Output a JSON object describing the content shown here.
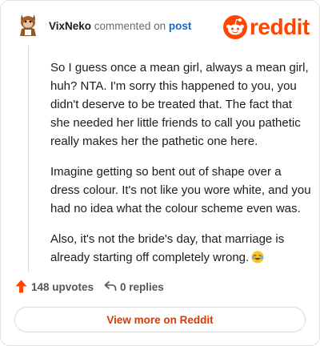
{
  "header": {
    "username": "VixNeko",
    "action_text": "commented on",
    "post_link_label": "post"
  },
  "brand": {
    "wordmark": "reddit",
    "color": "#ff4500"
  },
  "comment": {
    "paragraphs": [
      "So I guess once a mean girl, always a mean girl, huh? NTA. I'm sorry this happened to you, you didn't deserve to be treated that. The fact that she needed her little friends to call you pathetic really makes her the pathetic one here.",
      "Imagine getting so bent out of shape over a dress colour. It's not like you wore white, and you had no idea what the colour scheme even was.",
      "Also, it's not the bride's day, that marriage is already starting off completely wrong."
    ],
    "trailing_emoji": "laughing-tears-emoji"
  },
  "actions": {
    "upvotes_label": "148 upvotes",
    "replies_label": "0 replies",
    "upvote_color": "#ff4500"
  },
  "footer": {
    "view_more_label": "View more on Reddit",
    "accent_color": "#d93a00"
  }
}
